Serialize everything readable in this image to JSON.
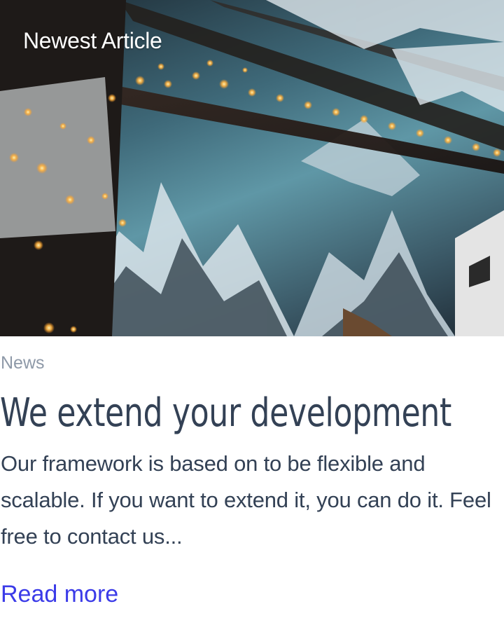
{
  "hero": {
    "label": "Newest Article"
  },
  "article": {
    "category": "News",
    "title": "We extend your development",
    "excerpt": "Our framework is based on to be flexible and scalable. If you want to extend it, you can do it. Feel free to contact us...",
    "read_more_label": "Read more"
  },
  "colors": {
    "text": "#334155",
    "muted": "#8e99a8",
    "link": "#3b3be8"
  }
}
